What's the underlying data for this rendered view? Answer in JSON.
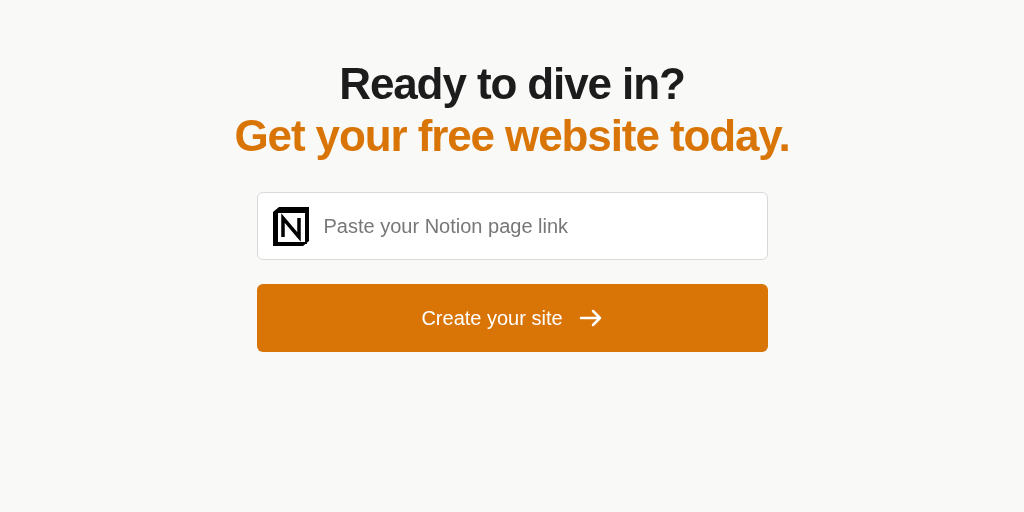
{
  "heading": {
    "line_1": "Ready to dive in?",
    "line_2": "Get your free website today."
  },
  "link_field": {
    "placeholder": "Paste your Notion page link"
  },
  "create_button": {
    "label": "Create your site"
  }
}
